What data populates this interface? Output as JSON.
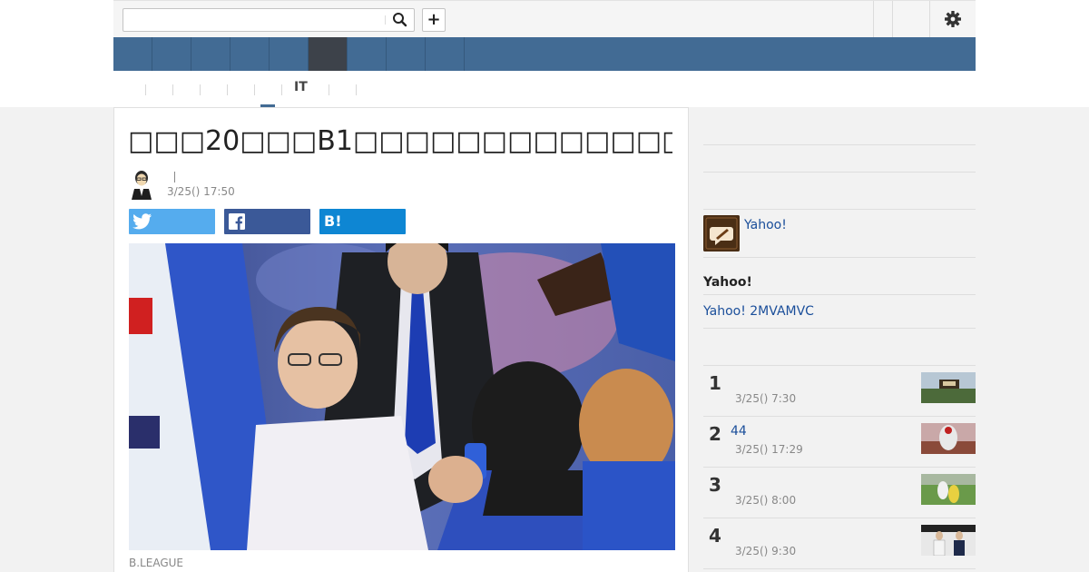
{
  "colors": {
    "brand_nav": "#426b94",
    "nav_active": "#3d424a",
    "twitter": "#55acee",
    "facebook": "#3b5998",
    "hatena": "#0e86d3",
    "link": "#1a4e9a"
  },
  "header": {
    "search_placeholder": "",
    "search_icon": "search-icon",
    "plus_label": "+",
    "settings_icon": "gear-icon"
  },
  "subnav": {
    "items": [
      "IT"
    ]
  },
  "article": {
    "headline": "□□□20□□□B1□□□□□□□□□□□□□□□□□□□□□□",
    "author_separator": "|",
    "date": "3/25() 17:50",
    "share": {
      "hatena_label": "B!"
    },
    "photo_caption": "B.LEAGUE"
  },
  "sidebar": {
    "yahoo_link": "Yahoo!",
    "section_title": "Yahoo!",
    "section_link": "Yahoo! 2MVAMVC",
    "ranking": [
      {
        "rank": "1",
        "title": "",
        "date": "3/25() 7:30"
      },
      {
        "rank": "2",
        "title": "44",
        "date": "3/25() 17:29"
      },
      {
        "rank": "3",
        "title": "",
        "date": "3/25() 8:00"
      },
      {
        "rank": "4",
        "title": "",
        "date": "3/25() 9:30"
      }
    ]
  }
}
